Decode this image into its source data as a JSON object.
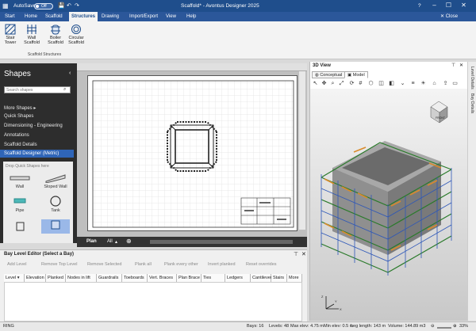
{
  "titlebar": {
    "autosave_label": "AutoSave",
    "autosave_state": "Off",
    "title": "Scaffold* - Avontus Designer 2025",
    "help": "?",
    "close_drawing": "Close Drawing"
  },
  "tabs": [
    "Start",
    "Home",
    "Scaffold",
    "Structures",
    "Drawing",
    "Import/Export",
    "View",
    "Help"
  ],
  "active_tab": "Structures",
  "ribbon": {
    "buttons": [
      {
        "label": "Stair Tower"
      },
      {
        "label": "Wall Scaffold"
      },
      {
        "label": "Boiler Scaffold"
      },
      {
        "label": "Circular Scaffold"
      }
    ],
    "group_label": "Scaffold Structures"
  },
  "shapes": {
    "title": "Shapes",
    "search_placeholder": "Search shapes",
    "items": [
      "More Shapes",
      "Quick Shapes",
      "Dimensioning - Engineering",
      "Annotations",
      "Scaffold Details",
      "Scaffold Designer (Metric)"
    ],
    "selected_item": "Scaffold Designer (Metric)",
    "stencil_hint": "Drop Quick Shapes here",
    "stencil_shapes": [
      "Wall",
      "Sloped Wall",
      "Pipe",
      "Tank"
    ]
  },
  "pagebar": {
    "page": "Plan",
    "all": "All"
  },
  "bay_editor": {
    "title": "Bay Level Editor (Select a Bay)",
    "tools": [
      "Add Level",
      "Remove Top Level",
      "Remove Selected",
      "Plank all",
      "Plank every other",
      "Invert planked",
      "Reset overrides"
    ],
    "columns": [
      "Level",
      "Elevation",
      "Planked",
      "Nodes in lift",
      "Guardrails",
      "Toeboards",
      "Vert. Braces",
      "Plan Brace",
      "Ties",
      "Ledgers",
      "Cantilever",
      "Stairs",
      "More"
    ]
  },
  "view3d": {
    "title": "3D View",
    "tabs": [
      "Conceptual",
      "Model"
    ],
    "active_tab": "Model",
    "cube_face": "FRONT"
  },
  "rightrail": [
    "Level Details",
    "Bay Details"
  ],
  "status": {
    "mode": "RING",
    "bays": "Bays: 16",
    "levels": "Levels: 48",
    "max_elev": "Max elev: 4.75 m",
    "min_elev": "Min elev: 0.5 m",
    "leg_length": "Leg length: 143 m",
    "volume": "Volume: 144.89 m3",
    "zoom": "33%"
  }
}
